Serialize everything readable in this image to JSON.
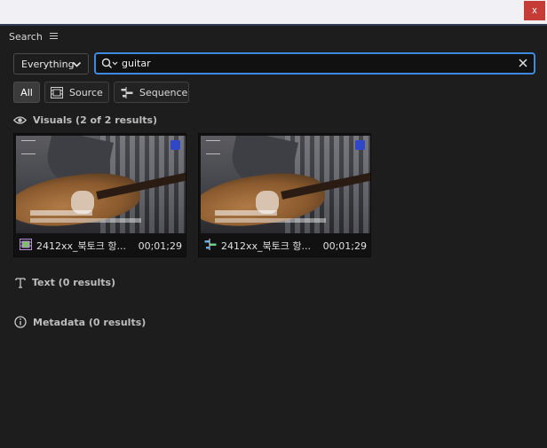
{
  "window": {
    "close_label": "x"
  },
  "panel": {
    "title": "Search"
  },
  "scope": {
    "selected": "Everything"
  },
  "search": {
    "value": "guitar"
  },
  "filters": [
    {
      "label": "All"
    },
    {
      "label": "Source"
    },
    {
      "label": "Sequence"
    }
  ],
  "sections": {
    "visuals": "Visuals (2 of 2 results)",
    "text": "Text (0 results)",
    "metadata": "Metadata (0 results)"
  },
  "results": [
    {
      "name": "2412xx_북토크 항...",
      "duration": "00;01;29",
      "kind_icon": "source-clip-icon"
    },
    {
      "name": "2412xx_북토크 항...",
      "duration": "00;01;29",
      "kind_icon": "sequence-icon"
    }
  ],
  "colors": {
    "accent": "#3d8ae0",
    "close": "#c63c36",
    "background": "#1d1d1d"
  }
}
